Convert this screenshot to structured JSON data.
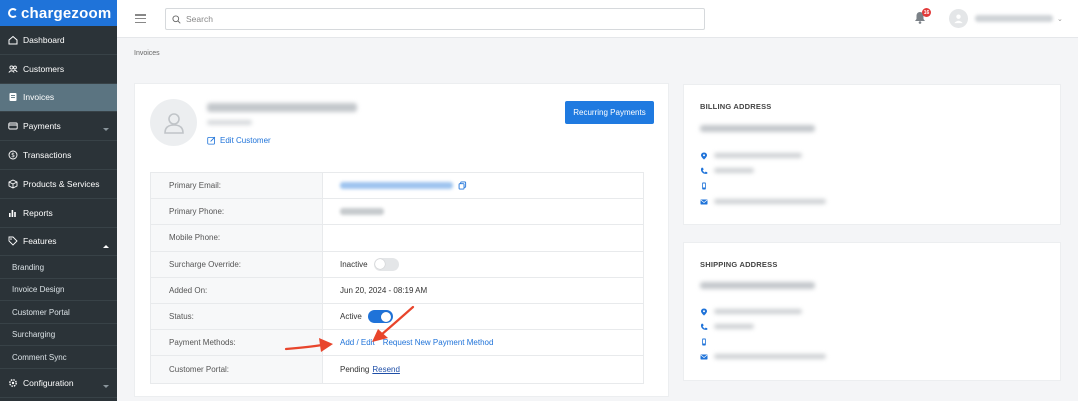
{
  "app": {
    "logo_text": "chargezoom",
    "accent_color": "#1f73d9"
  },
  "sidebar": {
    "items": [
      {
        "label": "Dashboard",
        "icon": "home-icon"
      },
      {
        "label": "Customers",
        "icon": "users-icon"
      },
      {
        "label": "Invoices",
        "icon": "invoice-icon",
        "active": true
      },
      {
        "label": "Payments",
        "icon": "card-icon",
        "caret": "down"
      },
      {
        "label": "Transactions",
        "icon": "dollar-icon"
      },
      {
        "label": "Products & Services",
        "icon": "box-icon"
      },
      {
        "label": "Reports",
        "icon": "bar-chart-icon"
      },
      {
        "label": "Features",
        "icon": "tag-icon",
        "caret": "up"
      }
    ],
    "sub_items": [
      "Branding",
      "Invoice Design",
      "Customer Portal",
      "Surcharging",
      "Comment Sync"
    ],
    "bottom_item": {
      "label": "Configuration",
      "icon": "gear-icon",
      "caret": "down"
    }
  },
  "topbar": {
    "search_placeholder": "Search",
    "notification_count": "16"
  },
  "breadcrumb": "Invoices",
  "customer": {
    "edit_label": "Edit Customer",
    "recurring_button": "Recurring Payments",
    "fields": {
      "primary_email_label": "Primary Email:",
      "primary_phone_label": "Primary Phone:",
      "mobile_phone_label": "Mobile Phone:",
      "surcharge_label": "Surcharge Override:",
      "surcharge_value": "Inactive",
      "added_on_label": "Added On:",
      "added_on_value": "Jun 20, 2024 - 08:19 AM",
      "status_label": "Status:",
      "status_value": "Active",
      "payment_methods_label": "Payment Methods:",
      "add_edit_link": "Add / Edit",
      "request_link": "Request New Payment Method",
      "portal_label": "Customer Portal:",
      "portal_value": "Pending",
      "resend_link": "Resend"
    }
  },
  "billing": {
    "title": "BILLING ADDRESS"
  },
  "shipping": {
    "title": "SHIPPING ADDRESS"
  },
  "annotations": {
    "arrow_color": "#e8452c"
  }
}
